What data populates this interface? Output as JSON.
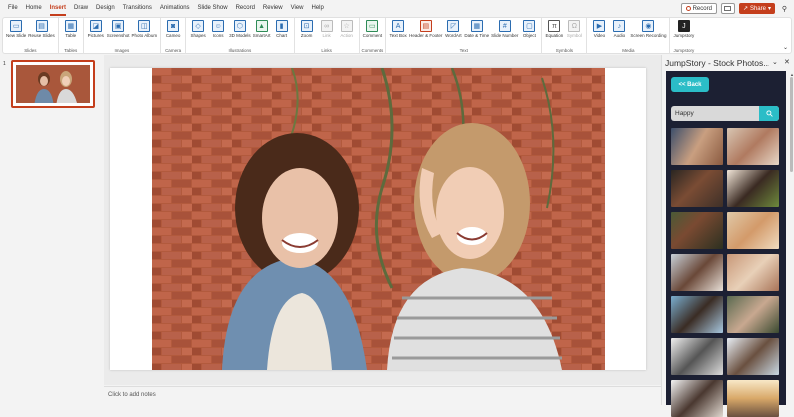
{
  "menu": {
    "tabs": [
      "File",
      "Home",
      "Insert",
      "Draw",
      "Design",
      "Transitions",
      "Animations",
      "Slide Show",
      "Record",
      "Review",
      "View",
      "Help"
    ],
    "active": "Insert",
    "record_label": "Record",
    "share_label": "Share"
  },
  "ribbon": {
    "groups": [
      {
        "label": "Slides",
        "buttons": [
          "New Slide",
          "Reuse Slides"
        ]
      },
      {
        "label": "Tables",
        "buttons": [
          "Table"
        ]
      },
      {
        "label": "Images",
        "buttons": [
          "Pictures",
          "Screenshot",
          "Photo Album"
        ]
      },
      {
        "label": "Camera",
        "buttons": [
          "Cameo"
        ]
      },
      {
        "label": "Illustrations",
        "buttons": [
          "Shapes",
          "Icons",
          "3D Models",
          "SmartArt",
          "Chart"
        ]
      },
      {
        "label": "Links",
        "buttons": [
          "Zoom",
          "Link",
          "Action"
        ]
      },
      {
        "label": "Comments",
        "buttons": [
          "Comment"
        ]
      },
      {
        "label": "Text",
        "buttons": [
          "Text Box",
          "Header & Footer",
          "WordArt",
          "Date & Time",
          "Slide Number",
          "Object"
        ]
      },
      {
        "label": "Symbols",
        "buttons": [
          "Equation",
          "Symbol"
        ]
      },
      {
        "label": "Media",
        "buttons": [
          "Video",
          "Audio",
          "Screen Recording"
        ]
      },
      {
        "label": "Jumpstory",
        "buttons": [
          "Jumpstory"
        ]
      }
    ]
  },
  "thumbnails": {
    "slide_number": "1"
  },
  "notes": {
    "placeholder": "Click to add notes"
  },
  "panel": {
    "title": "JumpStory - Stock Photos...",
    "back_label": "<< Back",
    "search_value": "Happy"
  },
  "colors": {
    "accent": "#c43e1c",
    "teal": "#2bbdc7",
    "panel_bg": "#1c2033"
  }
}
